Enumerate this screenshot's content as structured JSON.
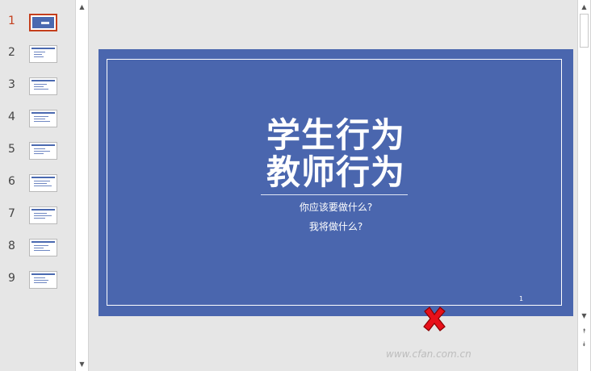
{
  "thumbnails": [
    {
      "num": "1",
      "active": true
    },
    {
      "num": "2",
      "active": false
    },
    {
      "num": "3",
      "active": false
    },
    {
      "num": "4",
      "active": false
    },
    {
      "num": "5",
      "active": false
    },
    {
      "num": "6",
      "active": false
    },
    {
      "num": "7",
      "active": false
    },
    {
      "num": "8",
      "active": false
    },
    {
      "num": "9",
      "active": false
    }
  ],
  "slide": {
    "title_line1": "学生行为",
    "title_line2": "教师行为",
    "subtitle_line1": "你应该要做什么?",
    "subtitle_line2": "我将做什么?",
    "page_number": "1"
  },
  "watermark": "www.cfan.com.cn",
  "colors": {
    "slide_bg": "#4a66ae",
    "active_thumb_border": "#c43e1c",
    "mark_red": "#e8101a"
  },
  "icons": {
    "scroll_up": "▲",
    "scroll_down": "▼",
    "prev_slide": "⯭",
    "next_slide": "⯯"
  }
}
